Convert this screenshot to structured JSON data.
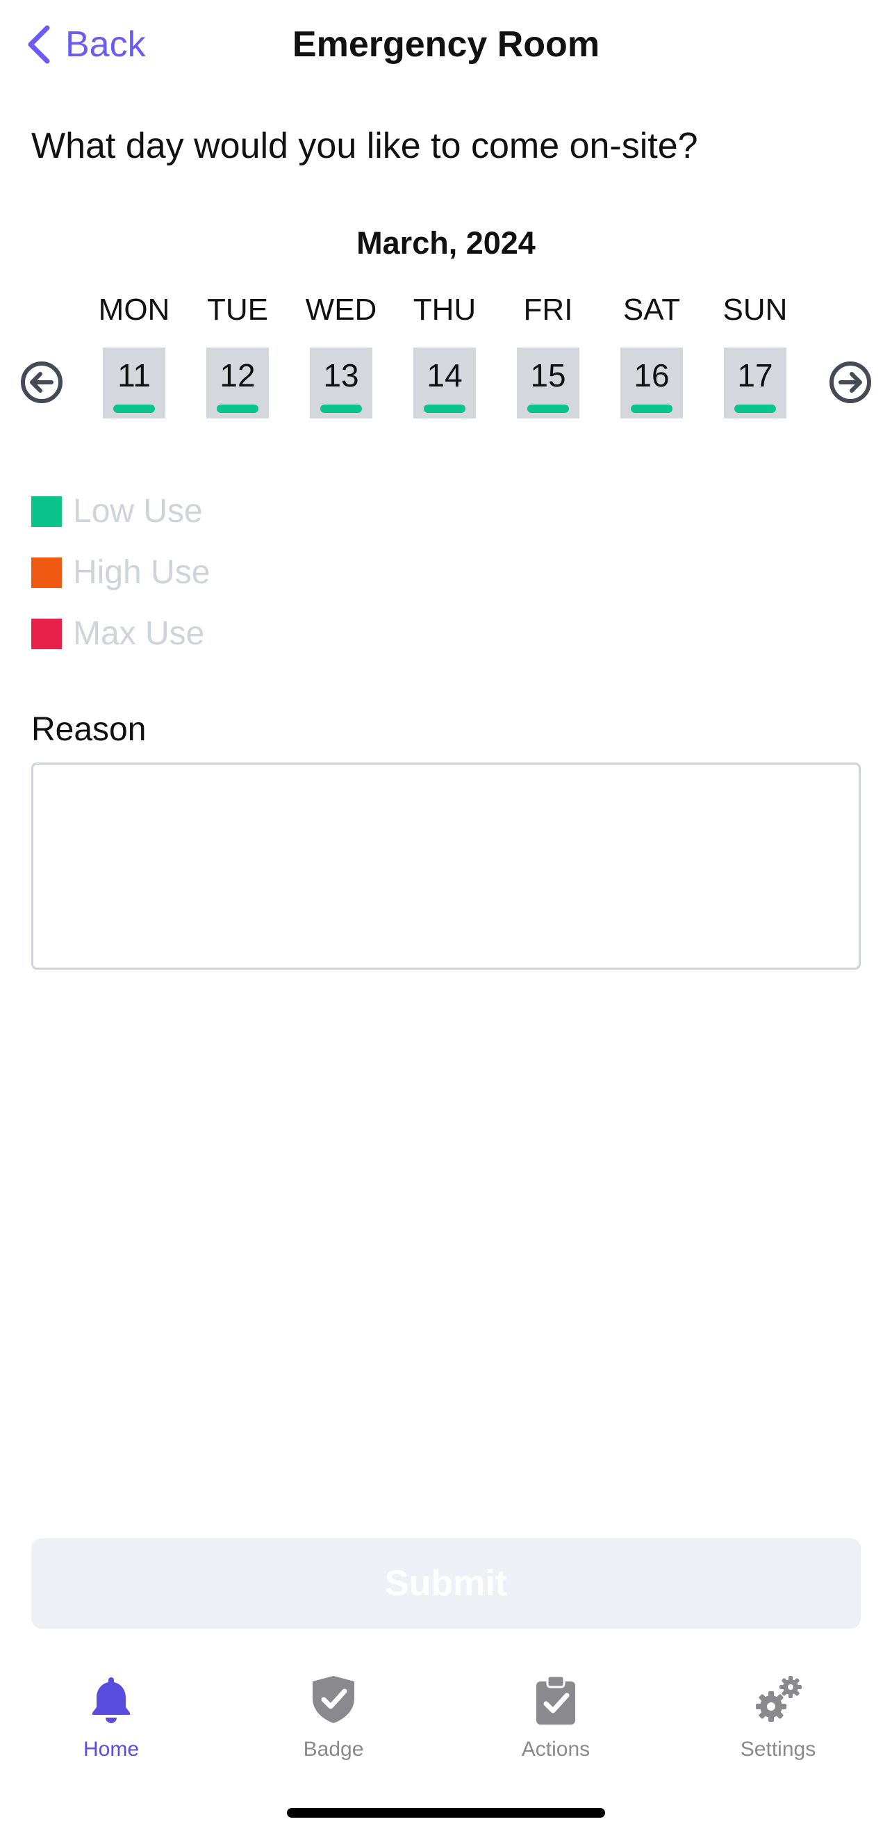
{
  "header": {
    "back_label": "Back",
    "title": "Emergency Room"
  },
  "question": "What day would you like to come on-site?",
  "calendar": {
    "month_label": "March, 2024",
    "day_names": [
      "MON",
      "TUE",
      "WED",
      "THU",
      "FRI",
      "SAT",
      "SUN"
    ],
    "dates": [
      "11",
      "12",
      "13",
      "14",
      "15",
      "16",
      "17"
    ],
    "usage_color": "#0bc48c",
    "prev_icon": "arrow-left-circle-icon",
    "next_icon": "arrow-right-circle-icon"
  },
  "legend": {
    "items": [
      {
        "label": "Low Use",
        "color": "#0bc48c"
      },
      {
        "label": "High Use",
        "color": "#f05a12"
      },
      {
        "label": "Max Use",
        "color": "#e8214a"
      }
    ]
  },
  "reason": {
    "label": "Reason",
    "value": ""
  },
  "submit_label": "Submit",
  "tabbar": {
    "active": "Home",
    "tabs": [
      {
        "label": "Home",
        "icon": "bell-icon"
      },
      {
        "label": "Badge",
        "icon": "shield-check-icon"
      },
      {
        "label": "Actions",
        "icon": "clipboard-check-icon"
      },
      {
        "label": "Settings",
        "icon": "gears-icon"
      }
    ]
  },
  "colors": {
    "accent": "#6a5cf0",
    "active_tab": "#5b4ce0",
    "inactive_tab": "#8a8a8e"
  }
}
